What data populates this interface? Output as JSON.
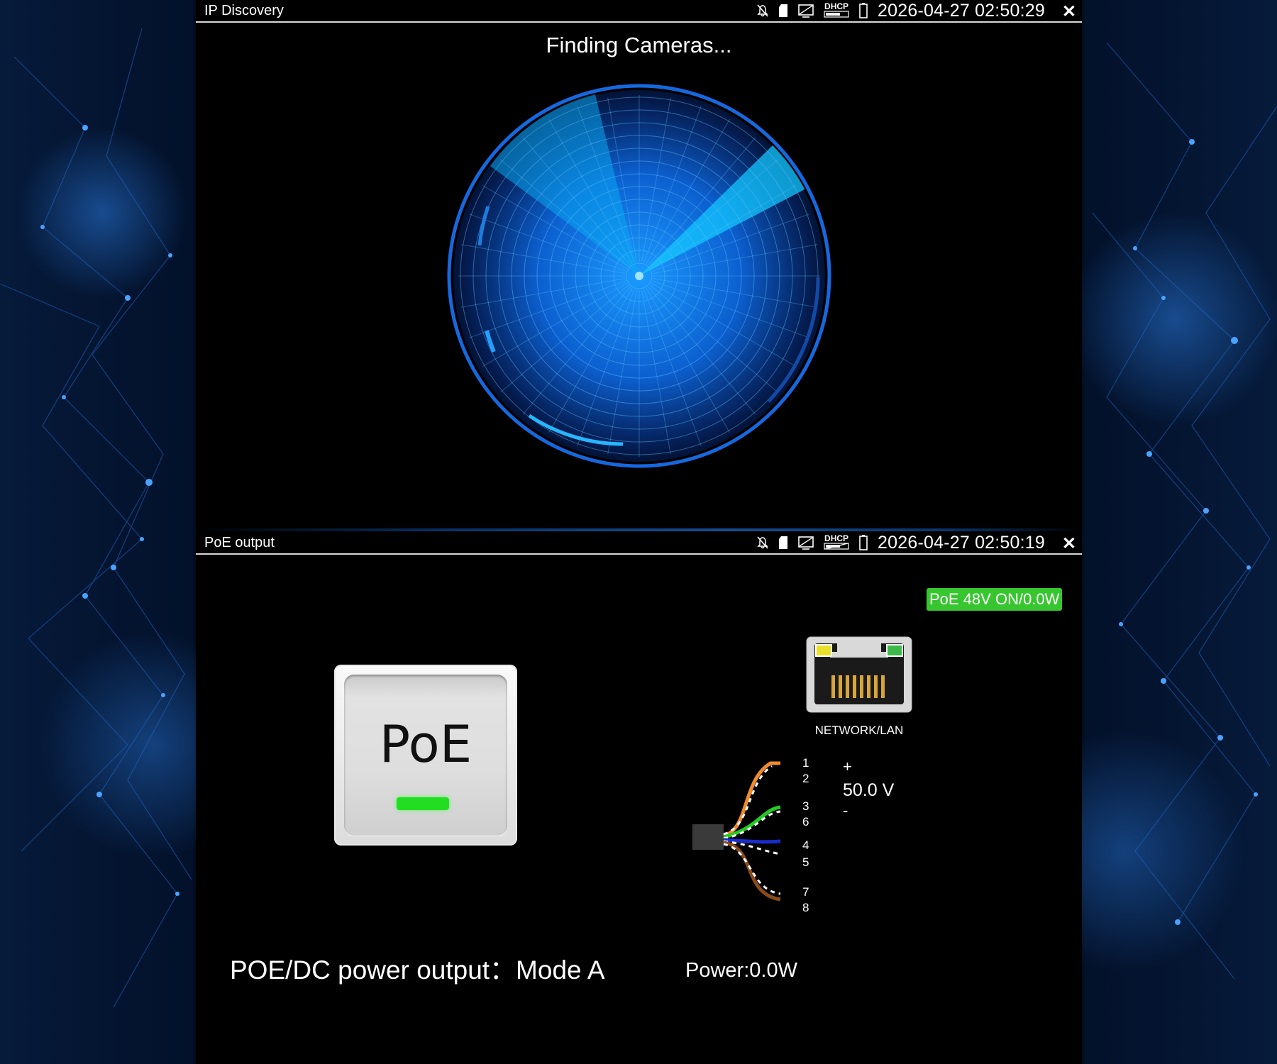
{
  "top_panel": {
    "title": "IP Discovery",
    "datetime": "2026-04-27 02:50:29",
    "dhcp_label": "DHCP",
    "close_glyph": "✕",
    "status_icons": [
      "mute-icon",
      "sd-card-icon",
      "screen-icon",
      "dhcp-icon",
      "battery-icon"
    ],
    "finding_text": "Finding Cameras..."
  },
  "bottom_panel": {
    "title": "PoE output",
    "datetime": "2026-04-27 02:50:19",
    "dhcp_label": "DHCP",
    "close_glyph": "✕",
    "status_icons": [
      "mute-icon",
      "sd-card-icon",
      "screen-icon",
      "dhcp-icon",
      "battery-icon"
    ],
    "poe_status_badge": "PoE 48V ON/0.0W",
    "poe_button_label": "PoE",
    "network_label": "NETWORK/LAN",
    "pins": [
      "1",
      "2",
      "3",
      "6",
      "4",
      "5",
      "7",
      "8"
    ],
    "voltage_plus": "+",
    "voltage_value": "50.0 V",
    "voltage_minus": "-",
    "mode_text": "POE/DC power output：Mode A",
    "power_text": "Power:0.0W"
  },
  "colors": {
    "badge_green": "#37c62f",
    "radar_blue": "#1a7fe0",
    "radar_sweep": "#19d0ff",
    "led_green": "#22dd22"
  }
}
